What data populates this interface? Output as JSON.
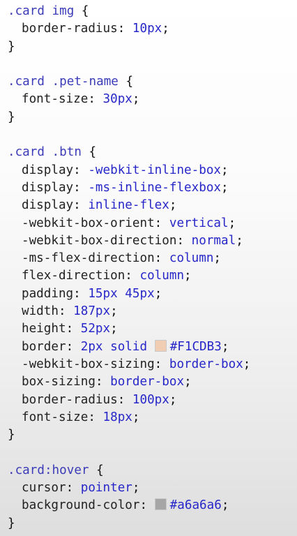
{
  "code": [
    {
      "kind": "open",
      "selector": ".card img",
      "brace": " {"
    },
    {
      "kind": "decl",
      "property": "border-radius",
      "value": "10px"
    },
    {
      "kind": "close",
      "brace": "}"
    },
    {
      "kind": "blank"
    },
    {
      "kind": "open",
      "selector": ".card .pet-name",
      "brace": " {"
    },
    {
      "kind": "decl",
      "property": "font-size",
      "value": "30px"
    },
    {
      "kind": "close",
      "brace": "}"
    },
    {
      "kind": "blank"
    },
    {
      "kind": "open",
      "selector": ".card .btn",
      "brace": " {"
    },
    {
      "kind": "decl",
      "property": "display",
      "value": "-webkit-inline-box"
    },
    {
      "kind": "decl",
      "property": "display",
      "value": "-ms-inline-flexbox"
    },
    {
      "kind": "decl",
      "property": "display",
      "value": "inline-flex"
    },
    {
      "kind": "decl",
      "property": "-webkit-box-orient",
      "value": "vertical"
    },
    {
      "kind": "decl",
      "property": "-webkit-box-direction",
      "value": "normal"
    },
    {
      "kind": "decl",
      "property": "-ms-flex-direction",
      "value": "column"
    },
    {
      "kind": "decl",
      "property": "flex-direction",
      "value": "column"
    },
    {
      "kind": "decl",
      "property": "padding",
      "value": "15px 45px"
    },
    {
      "kind": "decl",
      "property": "width",
      "value": "187px"
    },
    {
      "kind": "decl",
      "property": "height",
      "value": "52px"
    },
    {
      "kind": "decl",
      "property": "border",
      "value": "2px solid ",
      "swatch": "#F1CDB3",
      "value2": "#F1CDB3"
    },
    {
      "kind": "decl",
      "property": "-webkit-box-sizing",
      "value": "border-box"
    },
    {
      "kind": "decl",
      "property": "box-sizing",
      "value": "border-box"
    },
    {
      "kind": "decl",
      "property": "border-radius",
      "value": "100px"
    },
    {
      "kind": "decl",
      "property": "font-size",
      "value": "18px"
    },
    {
      "kind": "close",
      "brace": "}"
    },
    {
      "kind": "blank"
    },
    {
      "kind": "open",
      "selector": ".card:hover",
      "brace": " {"
    },
    {
      "kind": "decl",
      "property": "cursor",
      "value": "pointer"
    },
    {
      "kind": "decl",
      "property": "background-color",
      "value": "",
      "swatch": "#a6a6a6",
      "value2": "#a6a6a6"
    },
    {
      "kind": "close",
      "brace": "}"
    }
  ]
}
